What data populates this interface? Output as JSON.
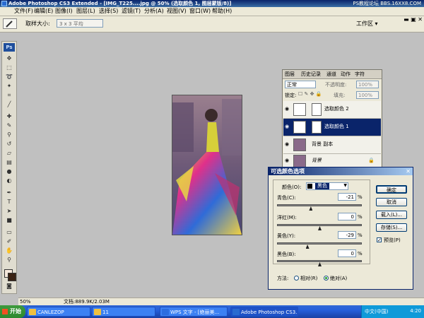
{
  "window": {
    "title": "Adobe Photoshop CS3 Extended - [IMG_T225....jpg @ 50% (选取颜色 1, 图层蒙版/8)]"
  },
  "menu": [
    "文件(F)",
    "编辑(E)",
    "图像(I)",
    "图层(L)",
    "选择(S)",
    "滤镜(T)",
    "分析(A)",
    "视图(V)",
    "窗口(W)",
    "帮助(H)"
  ],
  "options": {
    "sample_label": "取样大小:",
    "sample_value": "3 x 3 平均",
    "workspace": "工作区 ▾"
  },
  "toolbox": {
    "logo": "Ps"
  },
  "status": {
    "zoom": "50%",
    "doc": "文档:889.9K/2.03M"
  },
  "layers_panel": {
    "tabs": [
      "图层",
      "历史记录",
      "通道",
      "动作",
      "字符"
    ],
    "blend_mode": "正常",
    "opacity_label": "不透明度:",
    "opacity_value": "100%",
    "lock_label": "锁定:",
    "fill_label": "填充:",
    "fill_value": "100%",
    "layers": [
      {
        "name": "选取颜色 2",
        "selected": false
      },
      {
        "name": "选取颜色 1",
        "selected": true
      },
      {
        "name": "背景 副本",
        "selected": false
      },
      {
        "name": "背景",
        "selected": false
      }
    ]
  },
  "dialog": {
    "title": "可选颜色选项",
    "color_label": "颜色(O):",
    "color_value": "黑色",
    "sliders": [
      {
        "label": "青色(C):",
        "value": "-21",
        "fraction": 0.395
      },
      {
        "label": "洋红(M):",
        "value": "0",
        "fraction": 0.5
      },
      {
        "label": "黄色(Y):",
        "value": "-29",
        "fraction": 0.355
      },
      {
        "label": "黑色(B):",
        "value": "0",
        "fraction": 0.5
      }
    ],
    "percent": "%",
    "buttons": {
      "ok": "确定",
      "cancel": "取消",
      "load": "载入(L)...",
      "save": "存储(S)..."
    },
    "preview_label": "预览(P)",
    "method_label": "方法:",
    "method_relative": "相对(R)",
    "method_absolute": "绝对(A)"
  },
  "taskbar": {
    "start": "开始",
    "tasks": [
      "CANLEZOP",
      "11",
      "WPS 文字 - [绝丽美...",
      "Adobe Photoshop CS3..."
    ],
    "lang": "中文(中国)",
    "clock": "4:20"
  },
  "watermark": "PS教程论坛 BBS.16XX8.COM"
}
